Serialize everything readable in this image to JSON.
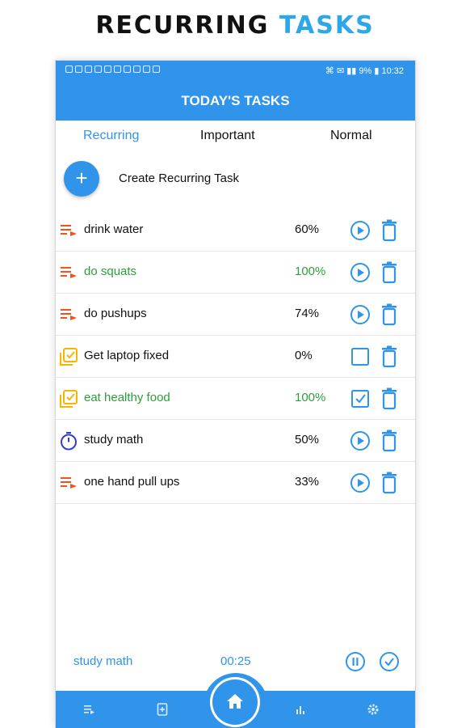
{
  "banner": {
    "word1": "RECURRING",
    "word2": "TASKS"
  },
  "status_bar": {
    "right_text": "⌘ ✉ ▮▮ 9% ▮ 10:32"
  },
  "app_bar": {
    "title": "TODAY'S TASKS"
  },
  "tabs": [
    {
      "label": "Recurring",
      "active": true
    },
    {
      "label": "Important",
      "active": false
    },
    {
      "label": "Normal",
      "active": false
    }
  ],
  "create": {
    "label": "Create Recurring Task",
    "button_icon": "plus-icon"
  },
  "tasks": [
    {
      "name": "drink water",
      "percent": "60%",
      "type_icon": "recurring-list-icon",
      "action_icon": "play-icon",
      "done": false
    },
    {
      "name": "do squats",
      "percent": "100%",
      "type_icon": "recurring-list-icon",
      "action_icon": "play-icon",
      "done": true
    },
    {
      "name": "do pushups",
      "percent": "74%",
      "type_icon": "recurring-list-icon",
      "action_icon": "play-icon",
      "done": false
    },
    {
      "name": "Get laptop fixed",
      "percent": "0%",
      "type_icon": "checklist-icon",
      "action_icon": "checkbox-empty-icon",
      "done": false
    },
    {
      "name": "eat healthy food",
      "percent": "100%",
      "type_icon": "checklist-icon",
      "action_icon": "checkbox-checked-icon",
      "done": true
    },
    {
      "name": "study math",
      "percent": "50%",
      "type_icon": "stopwatch-icon",
      "action_icon": "play-icon",
      "done": false
    },
    {
      "name": "one hand pull ups",
      "percent": "33%",
      "type_icon": "recurring-list-icon",
      "action_icon": "play-icon",
      "done": false
    }
  ],
  "player": {
    "task_name": "study math",
    "time": "00:25"
  },
  "bottom_nav": [
    "list-icon",
    "document-icon",
    "home-icon",
    "bar-chart-icon",
    "gear-icon"
  ],
  "colors": {
    "primary": "#2f94ea",
    "done_text": "#2e9d3a",
    "recurring_icon": "#f4511e",
    "checklist_icon": "#f7b500",
    "stopwatch_icon": "#2f3fd6"
  }
}
